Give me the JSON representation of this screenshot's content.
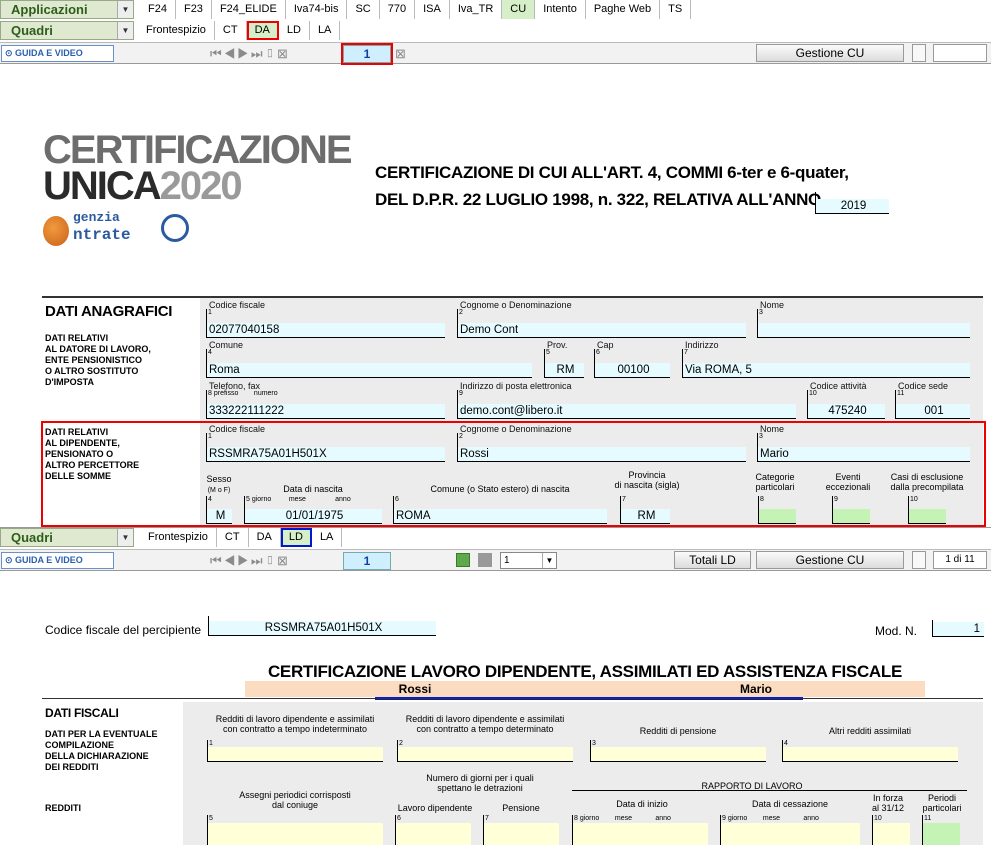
{
  "menu": {
    "applicazioni": "Applicazioni",
    "quadri": "Quadri"
  },
  "app_tabs": [
    "F24",
    "F23",
    "F24_ELIDE",
    "Iva74-bis",
    "SC",
    "770",
    "ISA",
    "Iva_TR",
    "CU",
    "Intento",
    "Paghe Web",
    "TS"
  ],
  "quadri_tabs": [
    "Frontespizio",
    "CT",
    "DA",
    "LD",
    "LA"
  ],
  "toolbar": {
    "guide": "GUIDA E VIDEO",
    "page": "1",
    "gestione": "Gestione CU",
    "totali": "Totali LD",
    "select": "1",
    "pager": "1 di 11"
  },
  "header": {
    "logo1": "CERTIFICAZIONE",
    "logo2a": "UNICA",
    "logo2b": "2020",
    "agency1": "genzia",
    "agency2": "ntrate",
    "title_l1": "CERTIFICAZIONE DI CUI ALL'ART. 4, COMMI 6-ter e 6-quater,",
    "title_l2": "DEL D.P.R. 22 LUGLIO 1998, n. 322, RELATIVA ALL'ANNO",
    "anno": "2019"
  },
  "anagrafici": {
    "title": "DATI ANAGRAFICI",
    "datore_label": "DATI RELATIVI\nAL DATORE DI LAVORO,\nENTE PENSIONISTICO\nO ALTRO SOSTITUTO\nD'IMPOSTA",
    "dip_label": "DATI RELATIVI\nAL DIPENDENTE,\nPENSIONATO O\nALTRO PERCETTORE\nDELLE SOMME",
    "cf_l": "Codice fiscale",
    "cf": "02077040158",
    "cogn_l": "Cognome o Denominazione",
    "cogn": "Demo Cont",
    "nome_l": "Nome",
    "nome": "",
    "com_l": "Comune",
    "com": "Roma",
    "prov_l": "Prov.",
    "prov": "RM",
    "cap_l": "Cap",
    "cap": "00100",
    "ind_l": "Indirizzo",
    "ind": "Via ROMA, 5",
    "tel_l": "Telefono, fax",
    "pref_l": "prefisso",
    "numero_l": "numero",
    "tel": "333222111222",
    "mail_l": "Indirizzo di posta elettronica",
    "mail": "demo.cont@libero.it",
    "att_l": "Codice attività",
    "att": "475240",
    "sede_l": "Codice sede",
    "sede": "001",
    "dcf": "RSSMRA75A01H501X",
    "dcogn": "Rossi",
    "dnome": "Mario",
    "sesso_l": "Sesso",
    "mf_l": "(M o F)",
    "sesso": "M",
    "nasc_l": "Data di nascita",
    "giorno_l": "giorno",
    "mese_l": "mese",
    "anno_l": "anno",
    "nasc": "01/01/1975",
    "cn_l": "Comune (o Stato estero) di nascita",
    "cn": "ROMA",
    "pn_l": "Provincia\ndi nascita (sigla)",
    "pn": "RM",
    "cat_l": "Categorie\nparticolari",
    "ev_l": "Eventi\neccezionali",
    "casi_l": "Casi di esclusione\ndalla precompilata"
  },
  "ld": {
    "cf_label": "Codice fiscale del percipiente",
    "cf": "RSSMRA75A01H501X",
    "mod_label": "Mod. N.",
    "mod": "1",
    "title": "CERTIFICAZIONE LAVORO DIPENDENTE, ASSIMILATI ED ASSISTENZA FISCALE",
    "cognome": "Rossi",
    "nome": "Mario",
    "fiscali": "DATI FISCALI",
    "eventuale": "DATI PER LA EVENTUALE\nCOMPILAZIONE\nDELLA DICHIARAZIONE\nDEI REDDITI",
    "redditi": "REDDITI",
    "f1": "Redditi di lavoro dipendente e assimilati\ncon contratto a tempo indeterminato",
    "f2": "Redditi di lavoro dipendente e assimilati\ncon contratto a tempo determinato",
    "f3": "Redditi di pensione",
    "f4": "Altri redditi assimilati",
    "f5": "Assegni periodici corrisposti\ndal coniuge",
    "giorni": "Numero di giorni per i quali\nspettano le detrazioni",
    "f6": "Lavoro dipendente",
    "f7": "Pensione",
    "rapporto": "RAPPORTO DI LAVORO",
    "f8": "Data di inizio",
    "f9": "Data di cessazione",
    "f10": "In forza\nal 31/12",
    "f11": "Periodi\nparticolari"
  }
}
